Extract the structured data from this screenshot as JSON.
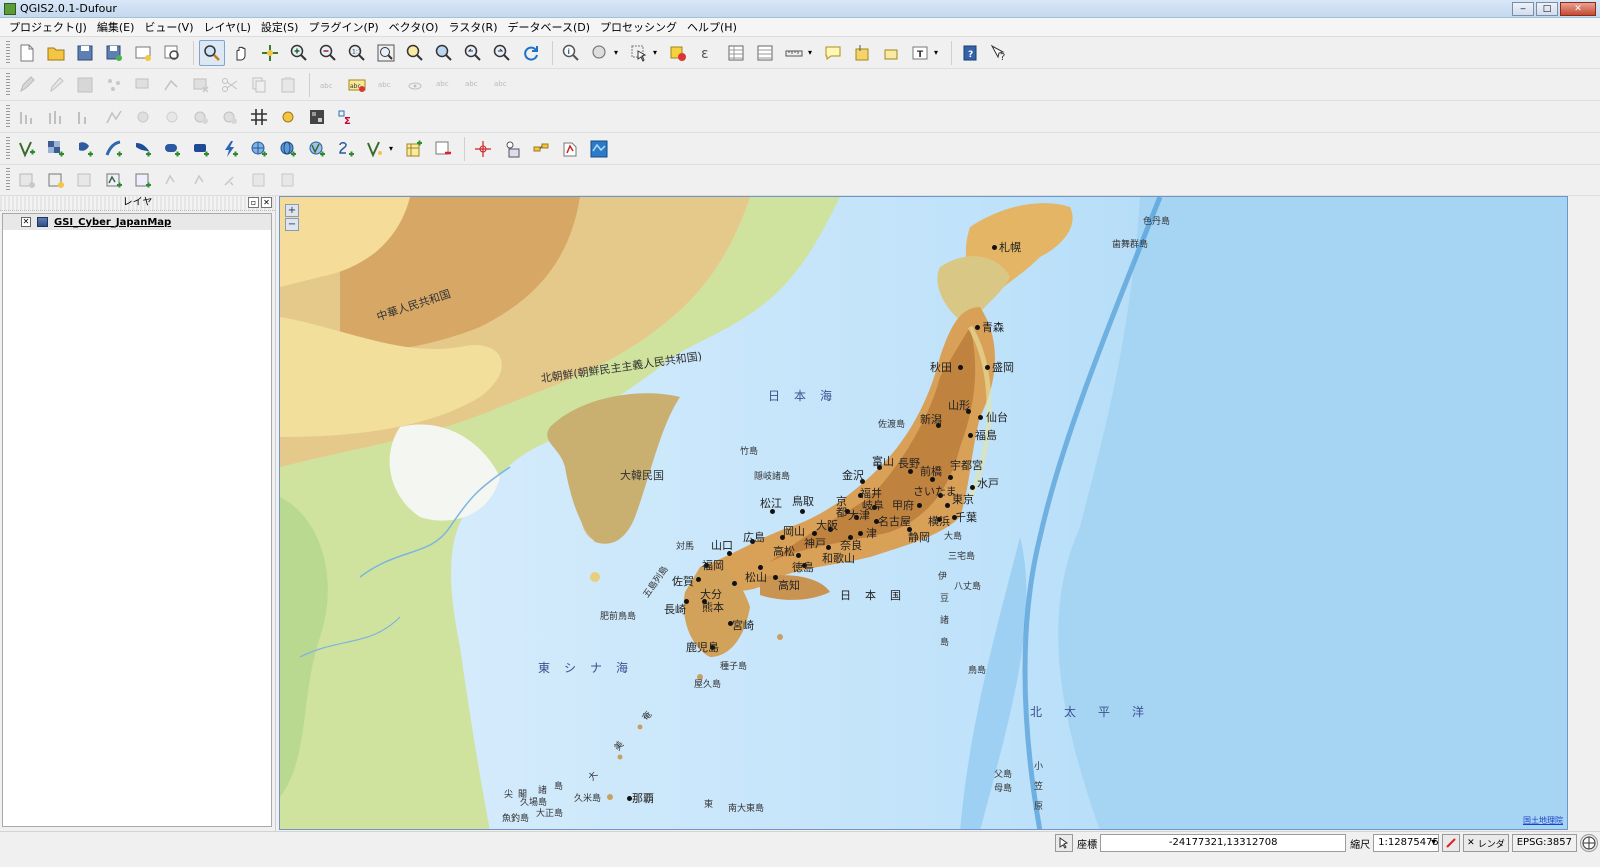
{
  "window": {
    "title": "QGIS2.0.1-Dufour",
    "minimize": "‒",
    "maximize": "□",
    "close": "✕"
  },
  "menu": [
    "プロジェクト(J)",
    "編集(E)",
    "ビュー(V)",
    "レイヤ(L)",
    "設定(S)",
    "プラグイン(P)",
    "ベクタ(O)",
    "ラスタ(R)",
    "データベース(D)",
    "プロセッシング",
    "ヘルプ(H)"
  ],
  "layers_panel": {
    "title": "レイヤ",
    "float_btn": "▫",
    "close_btn": "✕",
    "layers": [
      {
        "name": "GSI_Cyber_JapanMap",
        "checked": true,
        "check_mark": "✕"
      }
    ]
  },
  "map": {
    "zoom_in": "+",
    "zoom_out": "−",
    "attribution": "国土地理院",
    "countries": [
      {
        "text": "中華人民共和国"
      },
      {
        "text": "北朝鮮(朝鮮民主主義人民共和国)"
      },
      {
        "text": "大韓民国"
      },
      {
        "text": "日本国"
      }
    ],
    "seas": [
      {
        "text": "日本海"
      },
      {
        "text": "東シナ海"
      },
      {
        "text": "北太平洋"
      }
    ],
    "cities": [
      "札幌",
      "青森",
      "秋田",
      "盛岡",
      "山形",
      "仙台",
      "新潟",
      "福島",
      "富山",
      "金沢",
      "長野",
      "前橋",
      "宇都宮",
      "水戸",
      "福井",
      "さいたま",
      "東京",
      "岐阜",
      "甲府",
      "京都",
      "大津",
      "名古屋",
      "横浜",
      "千葉",
      "静岡",
      "津",
      "奈良",
      "大阪",
      "神戸",
      "和歌山",
      "鳥取",
      "松江",
      "岡山",
      "広島",
      "山口",
      "高松",
      "徳島",
      "松山",
      "高知",
      "福岡",
      "佐賀",
      "長崎",
      "熊本",
      "大分",
      "宮崎",
      "鹿児島",
      "那覇"
    ],
    "islands": [
      "色丹島",
      "歯舞群島",
      "佐渡島",
      "竹島",
      "隠岐諸島",
      "対馬",
      "五島列島",
      "肥前鳥島",
      "種子島",
      "屋久島",
      "大島",
      "三宅島",
      "八丈島",
      "鳥島",
      "父島",
      "母島",
      "久米島",
      "大正島",
      "南大東島",
      "伊",
      "豆",
      "諸",
      "島",
      "奄",
      "美",
      "大",
      "東",
      "小",
      "笠",
      "原",
      "尖",
      "閣",
      "諸",
      "島",
      "久場島",
      "魚釣島"
    ]
  },
  "statusbar": {
    "coord_label": "座標",
    "coord_value": "-24177321,13312708",
    "scale_label": "縮尺",
    "scale_value": "1:12875475",
    "render_label": "レンダ",
    "crs": "EPSG:3857",
    "render_check": "✕",
    "scale_dd": "▾"
  }
}
